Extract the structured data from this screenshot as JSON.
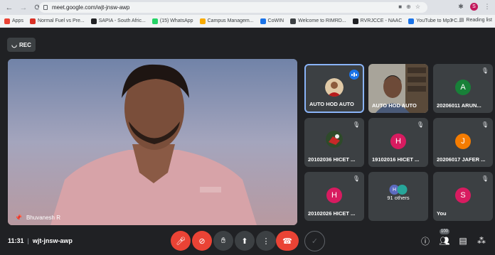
{
  "browser": {
    "url": "meet.google.com/wjt-jnsw-awp",
    "profile_initial": "S"
  },
  "bookmarks": {
    "items": [
      {
        "label": "Apps",
        "color": "#ea4335"
      },
      {
        "label": "Normal Fuel vs Pre...",
        "color": "#d93025"
      },
      {
        "label": "SAPIA - South Afric...",
        "color": "#202124"
      },
      {
        "label": "(15) WhatsApp",
        "color": "#25d366"
      },
      {
        "label": "Campus Managem...",
        "color": "#f9ab00"
      },
      {
        "label": "CoWIN",
        "color": "#1a73e8"
      },
      {
        "label": "Welcome to RIMRD...",
        "color": "#3c4043"
      },
      {
        "label": "RVRJCCE - NAAC",
        "color": "#202124"
      },
      {
        "label": "YouTube to Mp3 C...",
        "color": "#1a73e8"
      }
    ],
    "more": "»",
    "reading_list": "Reading list"
  },
  "meeting": {
    "rec_label": "REC",
    "presenter_name": "Bhuvanesh R",
    "time": "11:31",
    "code": "wjt-jnsw-awp",
    "participant_count": "100"
  },
  "tiles": [
    {
      "name": "AUTO HOD AUTO",
      "type": "photo",
      "active": true,
      "speaking": true
    },
    {
      "name": "AUTO HOD AUTO",
      "type": "video"
    },
    {
      "name": "20206011 ARUN...",
      "type": "initial",
      "initial": "A",
      "color": "#188038",
      "muted": true
    },
    {
      "name": "20102036 HICET ...",
      "type": "photo2",
      "muted": true
    },
    {
      "name": "19102016 HICET ...",
      "type": "initial",
      "initial": "H",
      "color": "#d81b60",
      "muted": true
    },
    {
      "name": "20206017 JAFER ...",
      "type": "initial",
      "initial": "J",
      "color": "#f57c00",
      "muted": true
    },
    {
      "name": "20102026 HICET ...",
      "type": "initial",
      "initial": "H",
      "color": "#d81b60",
      "muted": true
    },
    {
      "name": "91 others",
      "type": "others"
    },
    {
      "name": "You",
      "type": "initial",
      "initial": "S",
      "color": "#d81b60",
      "muted": true
    }
  ]
}
